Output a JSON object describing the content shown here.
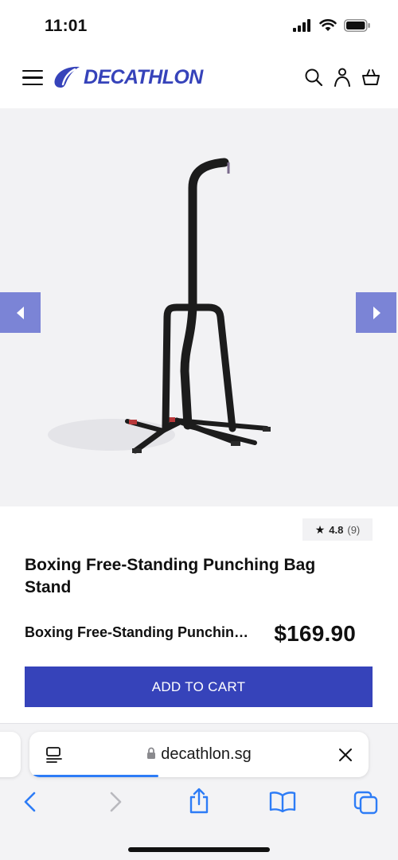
{
  "status_bar": {
    "time": "11:01",
    "icons": [
      "signal-icon",
      "wifi-icon",
      "battery-icon"
    ]
  },
  "header": {
    "brand": "DECATHLON",
    "icons": [
      "menu-icon",
      "search-icon",
      "account-icon",
      "basket-icon"
    ]
  },
  "gallery": {
    "image": "boxing punching bag stand",
    "prev_icon": "arrow-left-icon",
    "next_icon": "arrow-right-icon"
  },
  "product": {
    "rating_star": "★",
    "rating_value": "4.8",
    "review_count": "(9)",
    "title": "Boxing Free-Standing Punching Bag Stand",
    "sticky_name": "Boxing Free-Standing Punching Bag Stand",
    "price": "$169.90",
    "add_to_cart_label": "ADD TO CART"
  },
  "browser": {
    "url": "decathlon.sg",
    "load_progress": 0.37,
    "toolbar": [
      "back-icon",
      "forward-icon",
      "share-icon",
      "bookmarks-icon",
      "tabs-icon"
    ]
  },
  "colors": {
    "brand_blue": "#3643BA",
    "arrow_bg": "#7B84D6",
    "safari_blue": "#2D7CF6"
  }
}
